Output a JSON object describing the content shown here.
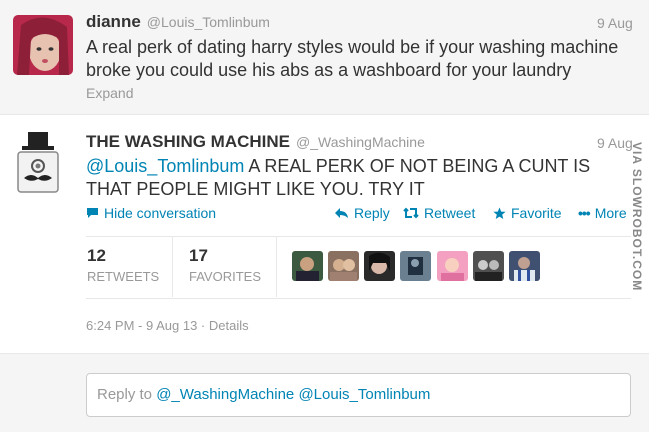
{
  "tweet1": {
    "name": "dianne",
    "handle": "@Louis_Tomlinbum",
    "time": "9 Aug",
    "text_line1": "A real perk of dating harry styles would be if your washing machine",
    "text_line2": "broke you could use his abs as a washboard for your laundry",
    "expand_label": "Expand"
  },
  "tweet2": {
    "name": "THE WASHING MACHINE",
    "handle": "@_WashingMachine",
    "time": "9 Aug",
    "mention": "@Louis_Tomlinbum",
    "text_line1_rest": " A REAL PERK OF NOT BEING A CUNT IS",
    "text_line2": "THAT PEOPLE MIGHT LIKE YOU. TRY IT",
    "hide_label": "Hide conversation",
    "reply_label": "Reply",
    "retweet_label": "Retweet",
    "favorite_label": "Favorite",
    "more_label": "More",
    "retweets_count": "12",
    "retweets_label": "RETWEETS",
    "favorites_count": "17",
    "favorites_label": "FAVORITES",
    "timestamp": "6:24 PM - 9 Aug 13",
    "separator": " · ",
    "details_label": "Details"
  },
  "reply": {
    "prefix": "Reply to ",
    "mentions": "@_WashingMachine @Louis_Tomlinbum"
  },
  "watermark": "VIA SLOWROBOT.COM",
  "colors": {
    "link": "#0084b4",
    "muted": "#999999",
    "background_alt": "#f5f5f5"
  }
}
